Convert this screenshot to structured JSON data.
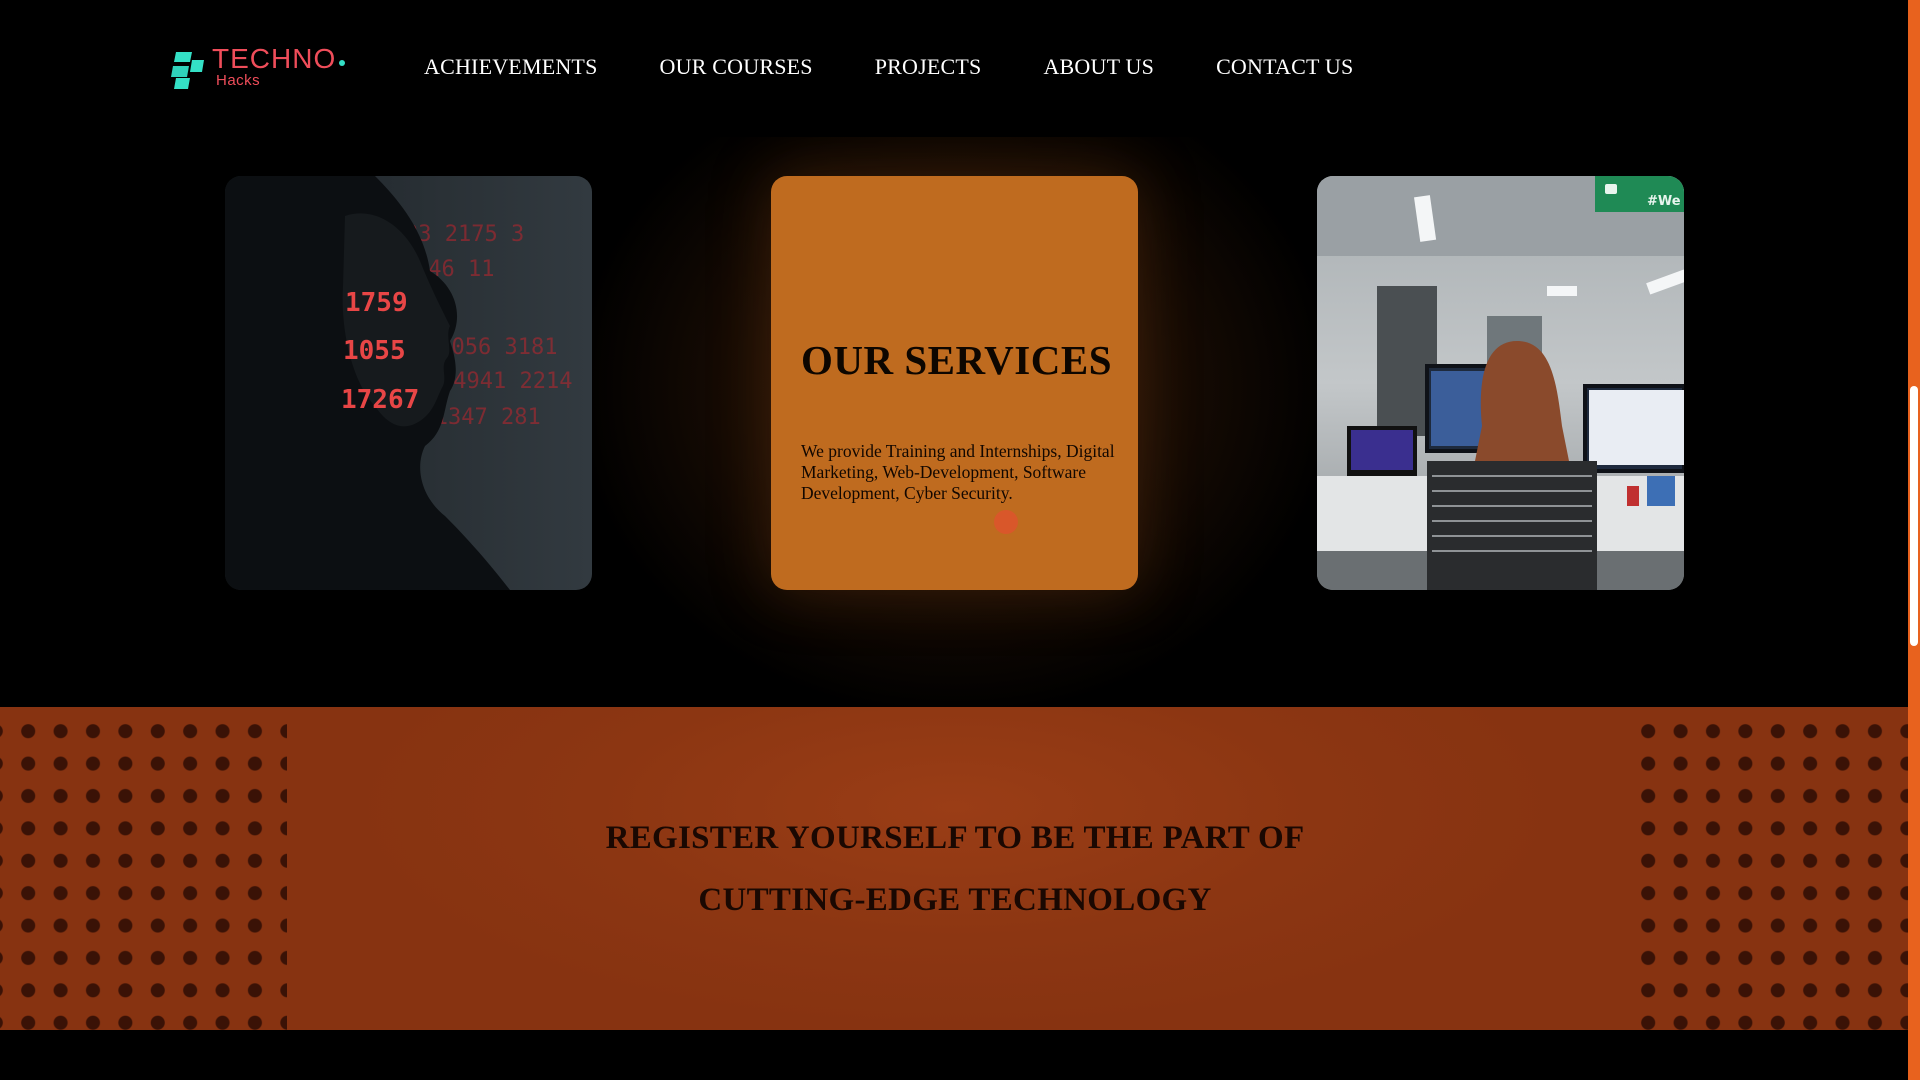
{
  "header": {
    "logo": {
      "title": "TECHNO",
      "subtitle": "Hacks"
    },
    "nav": [
      {
        "label": "ACHIEVEMENTS"
      },
      {
        "label": "OUR COURSES"
      },
      {
        "label": "PROJECTS"
      },
      {
        "label": "ABOUT US"
      },
      {
        "label": "CONTACT US"
      }
    ]
  },
  "services": {
    "title": "OUR SERVICES",
    "description": "We provide Training and Internships, Digital Marketing, Web-Development, Software Development, Cyber Security.",
    "left_image": {
      "overlay_text": [
        "1759",
        "1055",
        "17267"
      ]
    },
    "right_image": {
      "sign_text": "#We"
    }
  },
  "register": {
    "line1": "REGISTER YOURSELF TO BE THE PART OF",
    "line2": "CUTTING-EDGE TECHNOLOGY"
  },
  "colors": {
    "accent": "#bf6b1f",
    "banner": "#8c3612",
    "logo_red": "#ef4d5a",
    "logo_teal": "#34e0c6",
    "scrollbar": "#e8621e"
  }
}
